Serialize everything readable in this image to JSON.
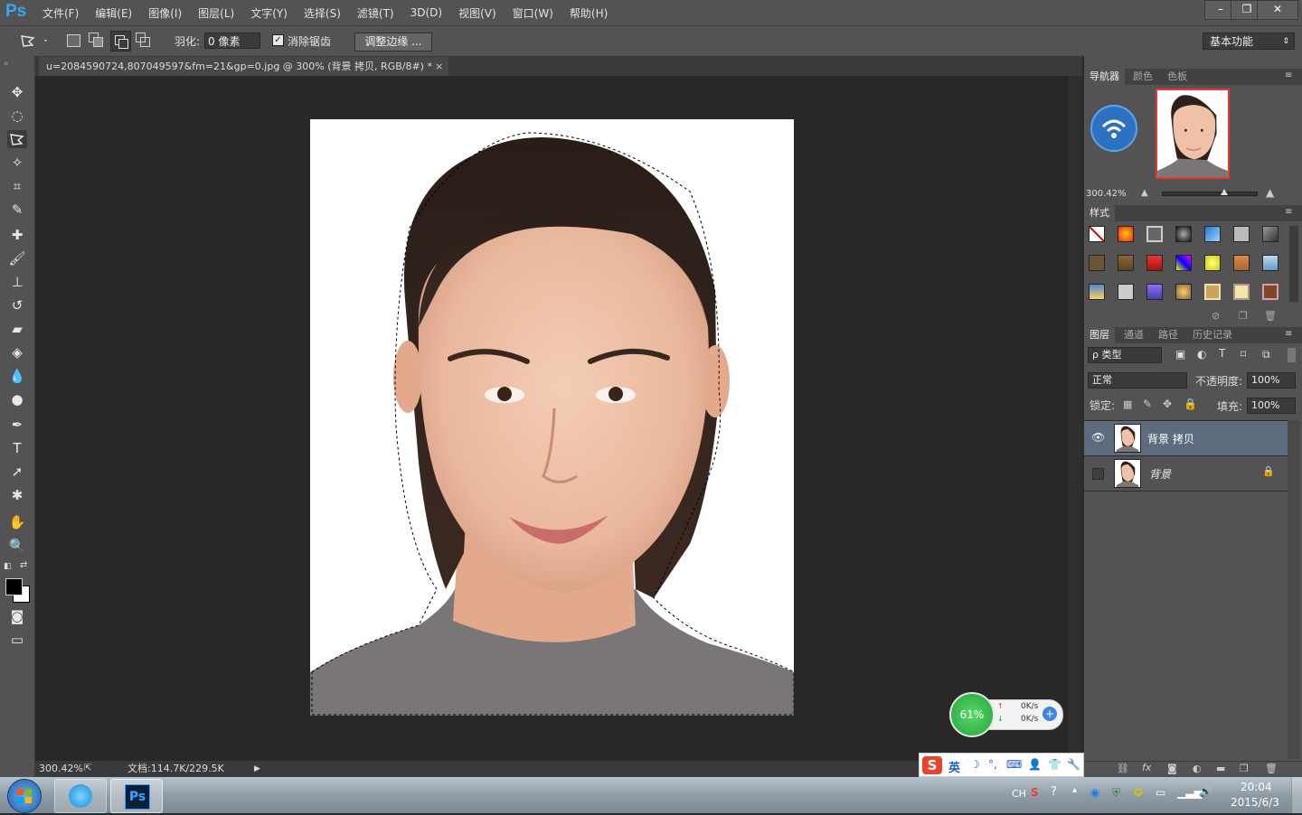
{
  "app": {
    "logo": "Ps"
  },
  "menu": [
    "文件(F)",
    "编辑(E)",
    "图像(I)",
    "图层(L)",
    "文字(Y)",
    "选择(S)",
    "滤镜(T)",
    "3D(D)",
    "视图(V)",
    "窗口(W)",
    "帮助(H)"
  ],
  "window_controls": {
    "minimize": "–",
    "restore": "❐",
    "close": "✕"
  },
  "options": {
    "feather_label": "羽化:",
    "feather_value": "0 像素",
    "antialias_label": "消除锯齿",
    "antialias_checked": true,
    "refine_edge_label": "调整边缘 ...",
    "workspace": "基本功能"
  },
  "document": {
    "tab_title": "u=2084590724,807049597&fm=21&gp=0.jpg @ 300% (背景 拷贝, RGB/8#) *",
    "tab_close": "×"
  },
  "status": {
    "zoom": "300.42%",
    "doc_size": "文档:114.7K/229.5K"
  },
  "navigator": {
    "tabs": [
      "导航器",
      "颜色",
      "色板"
    ],
    "zoom": "300.42%"
  },
  "styles": {
    "tab": "样式"
  },
  "layers": {
    "tabs": [
      "图层",
      "通道",
      "路径",
      "历史记录"
    ],
    "filter_kind": "ρ 类型",
    "blend_mode": "正常",
    "opacity_label": "不透明度:",
    "opacity_value": "100%",
    "lock_label": "锁定:",
    "fill_label": "填充:",
    "fill_value": "100%",
    "items": [
      {
        "name": "背景 拷贝",
        "visible": true,
        "selected": true,
        "locked": false
      },
      {
        "name": "背景",
        "visible": false,
        "selected": false,
        "locked": true
      }
    ]
  },
  "netmonitor": {
    "percent": "61%",
    "upload": "0K/s",
    "download": "0K/s"
  },
  "ime": {
    "mode": "英"
  },
  "taskbar": {
    "lang": "CH",
    "time": "20:04",
    "date": "2015/6/3",
    "ps_label": "Ps"
  },
  "colors": {
    "accent": "#33a6ff",
    "selected_layer": "#5c6b7e",
    "panel": "#535353",
    "canvas_bg": "#282828"
  }
}
